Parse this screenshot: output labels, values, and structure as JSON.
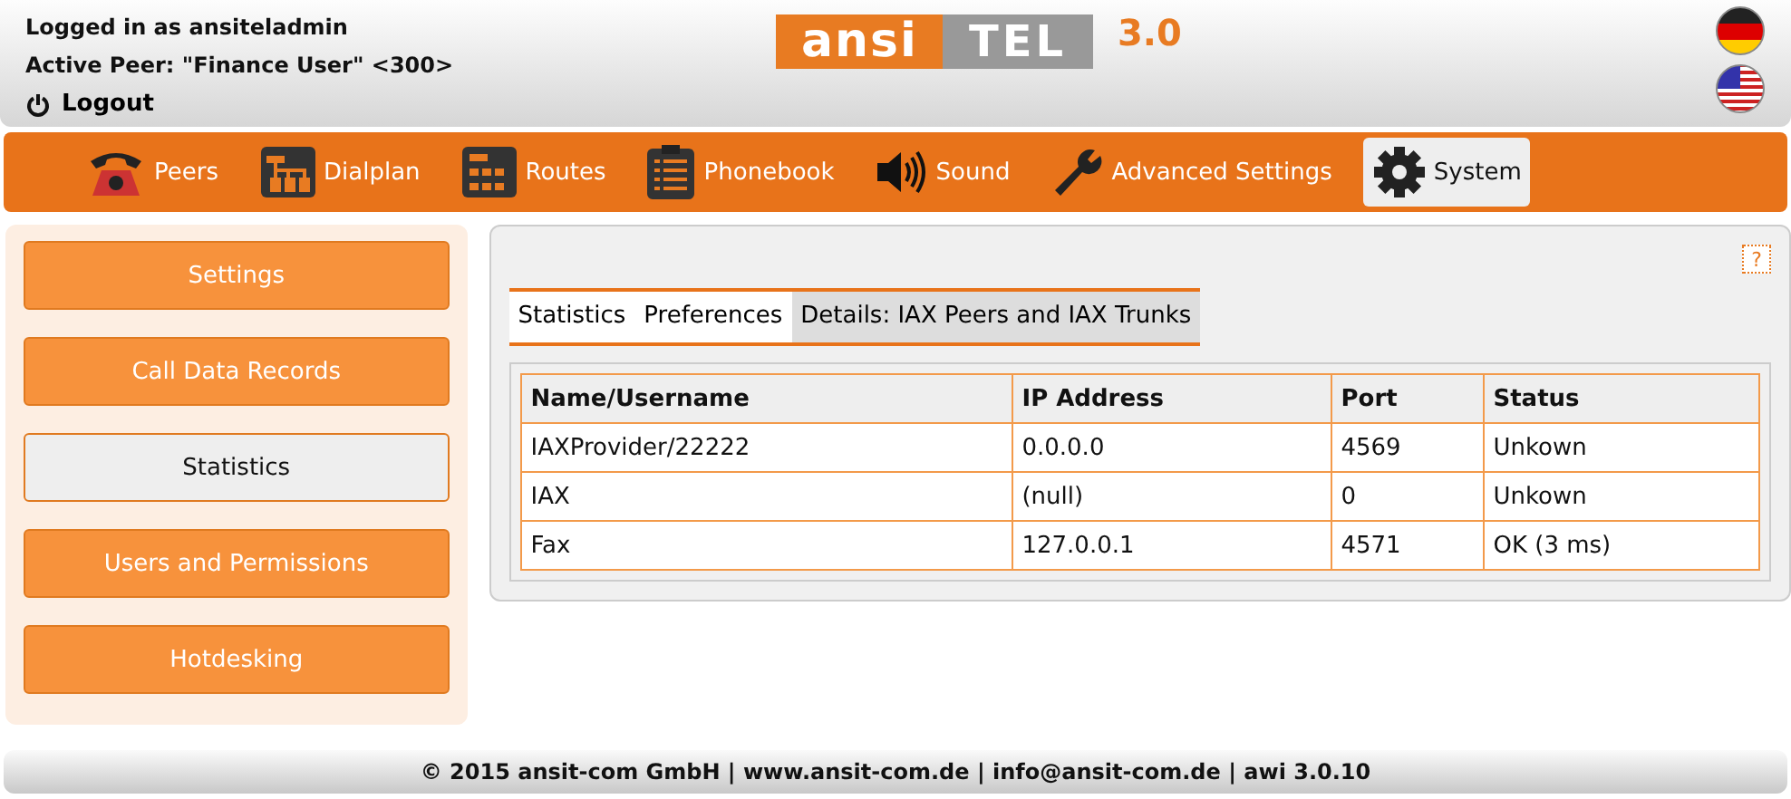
{
  "header": {
    "login_line": "Logged in as ansiteladmin",
    "peer_line": "Active Peer: \"Finance User\" <300>",
    "logout": "Logout",
    "logo": {
      "part_1": "ansi",
      "part_2": "TEL",
      "version": "3.0"
    }
  },
  "nav": [
    {
      "label": "Peers",
      "kind": "phone",
      "selected": false
    },
    {
      "label": "Dialplan",
      "kind": "dialplan",
      "selected": false
    },
    {
      "label": "Routes",
      "kind": "routes",
      "selected": false
    },
    {
      "label": "Phonebook",
      "kind": "phonebook",
      "selected": false
    },
    {
      "label": "Sound",
      "kind": "sound",
      "selected": false
    },
    {
      "label": "Advanced Settings",
      "kind": "wrench",
      "selected": false
    },
    {
      "label": "System",
      "kind": "gear",
      "selected": true
    }
  ],
  "sidebar": [
    {
      "label": "Settings",
      "selected": false
    },
    {
      "label": "Call Data Records",
      "selected": false
    },
    {
      "label": "Statistics",
      "selected": true
    },
    {
      "label": "Users and Permissions",
      "selected": false
    },
    {
      "label": "Hotdesking",
      "selected": false
    }
  ],
  "help": "?",
  "tabs": [
    {
      "label": "Statistics",
      "selected": false
    },
    {
      "label": "Preferences",
      "selected": false
    },
    {
      "label": "Details: IAX Peers and IAX Trunks",
      "selected": true
    }
  ],
  "table": {
    "columns": [
      "Name/Username",
      "IP Address",
      "Port",
      "Status"
    ],
    "rows": [
      [
        "IAXProvider/22222",
        "0.0.0.0",
        "4569",
        "Unkown"
      ],
      [
        "IAX",
        "(null)",
        "0",
        "Unkown"
      ],
      [
        "Fax",
        "127.0.0.1",
        "4571",
        "OK (3 ms)"
      ]
    ]
  },
  "footer": "© 2015 ansit-com GmbH | www.ansit-com.de | info@ansit-com.de | awi 3.0.10"
}
